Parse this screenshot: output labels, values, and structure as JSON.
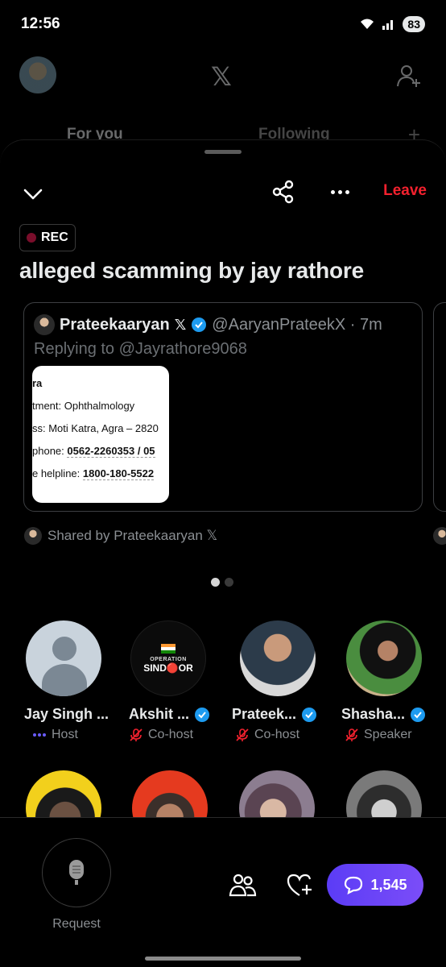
{
  "status_bar": {
    "time": "12:56",
    "battery": "83",
    "network": "5"
  },
  "background_header": {
    "tabs": [
      {
        "label": "For you"
      },
      {
        "label": "Following"
      }
    ]
  },
  "sheet": {
    "leave_label": "Leave",
    "rec_label": "REC",
    "title": "alleged scamming by jay rathore"
  },
  "tweet": {
    "name": "Prateekaaryan",
    "x_badge": "𝕏",
    "handle": "@AaryanPrateekX · 7m",
    "replying_prefix": "Replying to ",
    "replying_to": "@Jayrathore9068",
    "image_lines": [
      {
        "label": "ra",
        "value": ""
      },
      {
        "label": "tment: Ophthalmology",
        "value": ""
      },
      {
        "label": "ss: Moti Katra, Agra – 2820",
        "value": ""
      },
      {
        "label": "phone: ",
        "value": "0562-2260353 / 05"
      },
      {
        "label": "e helpline: ",
        "value": "1800-180-5522"
      }
    ]
  },
  "shared_by": "Shared by Prateekaaryan 𝕏",
  "participants": [
    {
      "name": "Jay Singh ...",
      "role": "Host",
      "verified": false,
      "role_icon": "speaking-dots-icon"
    },
    {
      "name": "Akshit ...",
      "role": "Co-host",
      "verified": true,
      "role_icon": "mic-muted-icon"
    },
    {
      "name": "Prateek...",
      "role": "Co-host",
      "verified": true,
      "role_icon": "mic-muted-icon"
    },
    {
      "name": "Shasha...",
      "role": "Speaker",
      "verified": true,
      "role_icon": "mic-muted-icon"
    }
  ],
  "avatar_text": {
    "operation": "OPERATION",
    "sindoor": "SIND🔴OR"
  },
  "bottom_bar": {
    "mic_label": "Request",
    "chat_count": "1,545"
  },
  "colors": {
    "leave": "#f4212e",
    "verified": "#1d9bf0",
    "chat_button": "#6a45f7",
    "host_dots": "#6a5cff",
    "muted": "#f4212e"
  }
}
